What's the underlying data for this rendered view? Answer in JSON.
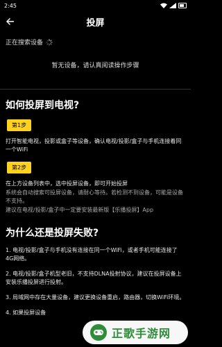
{
  "status": {
    "time": "2:45",
    "network": "WiFi",
    "signal": "LTE",
    "battery": "battery-icon"
  },
  "header": {
    "title": "投屏"
  },
  "search": {
    "status": "正在搜索设备"
  },
  "empty": {
    "text": "暂无设备，请认真阅读操作步骤"
  },
  "guide": {
    "title": "如何投屏到电视?",
    "step1": {
      "label": "第1步",
      "text": "打开智能电视，投影或盒子等设备，确认电视/投影/盒子与手机连接着同一个WiFi"
    },
    "step2": {
      "label": "第2步",
      "text": "在上方设备列表中，选中投屏设备，即可开始投屏",
      "note1": "系统会自动搜索可投屏设备，请耐心等待。若检测不到设备，可能是设备不支持。",
      "note2": "建议在电视/投影/盒子中一定要安装最新版【乐播投屏】App"
    }
  },
  "faq": {
    "title": "为什么还是投屏失败?",
    "items": [
      "1. 电视/投影/盒子与手机没有连接在同一个WiFi，或者手机可能连接了4G网络。",
      "2. 电视/投影/盒子机型老旧，不支持DLNA投射协议，建议在投屏设备上安装乐播投屏进行投射。",
      "3. 局域网中存在大量设备，建议更换设备重启，路由器，切换WiFi环境。",
      "4. 如果投屏设备"
    ]
  },
  "watermark": {
    "text": "正歌手游网",
    "accent": "#2f8d3a"
  },
  "colors": {
    "background": "#000000",
    "step_badge": "#ffd21f"
  }
}
